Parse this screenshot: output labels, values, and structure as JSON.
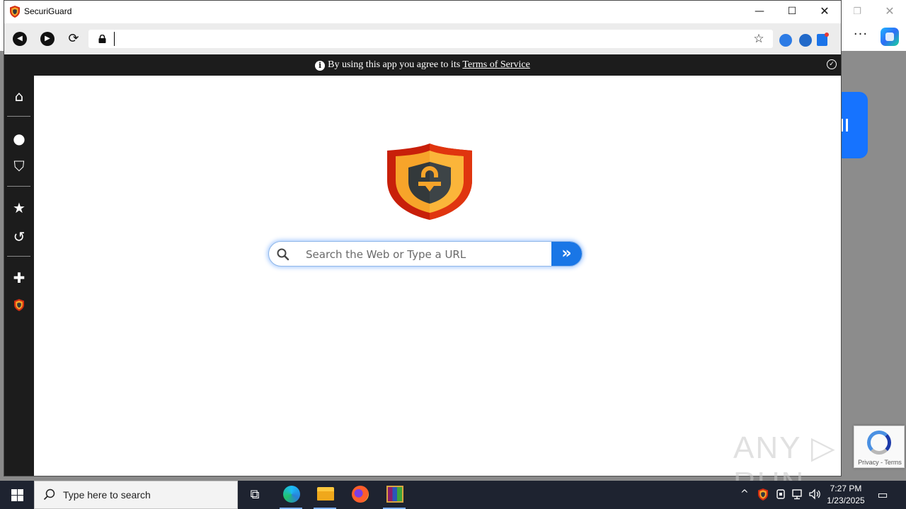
{
  "window": {
    "title": "SecuriGuard",
    "min_glyph": "—",
    "max_glyph": "☐",
    "close_glyph": "✕"
  },
  "toolbar": {
    "back_glyph": "◀",
    "forward_glyph": "▶",
    "refresh_glyph": "⟳",
    "address_value": "",
    "star_glyph": "☆",
    "extensions": [
      "extension-hand-icon",
      "extension-compass-icon",
      "extension-notes-icon"
    ]
  },
  "tos": {
    "info_glyph": "i",
    "prefix": "By using this app you agree to its ",
    "link": "Terms of Service",
    "dismiss_glyph": "✓"
  },
  "sidebar": {
    "items": [
      {
        "name": "home-icon",
        "glyph": "⌂"
      },
      {
        "name": "user-icon",
        "glyph": "●"
      },
      {
        "name": "shield-icon",
        "glyph": "⛉"
      },
      {
        "name": "star-icon",
        "glyph": "★"
      },
      {
        "name": "history-icon",
        "glyph": "↺"
      },
      {
        "name": "plus-icon",
        "glyph": "✚"
      },
      {
        "name": "securiguard-logo-icon",
        "glyph": ""
      }
    ]
  },
  "search": {
    "placeholder": "Search the Web or Type a URL",
    "value": "",
    "go_glyph": "»"
  },
  "watermark": "ANY ▷ RUN",
  "recaptcha": {
    "text": "Privacy - Terms"
  },
  "background_window": {
    "restore_glyph": "❐",
    "close_glyph": "✕",
    "more_glyph": "···"
  },
  "taskbar": {
    "search_placeholder": "Type here to search",
    "taskview_glyph": "⧉",
    "apps": [
      "edge-icon",
      "file-explorer-icon",
      "firefox-icon",
      "winrar-icon"
    ],
    "tray": {
      "chevron_glyph": "^",
      "clock_time": "7:27 PM",
      "clock_date": "1/23/2025",
      "notify_glyph": "▭"
    }
  },
  "colors": {
    "accent_blue": "#1976e6",
    "shield_red": "#d62d10",
    "shield_orange": "#f7a42a",
    "shield_dark": "#33393b",
    "dark_chrome": "#1c1c1c"
  }
}
